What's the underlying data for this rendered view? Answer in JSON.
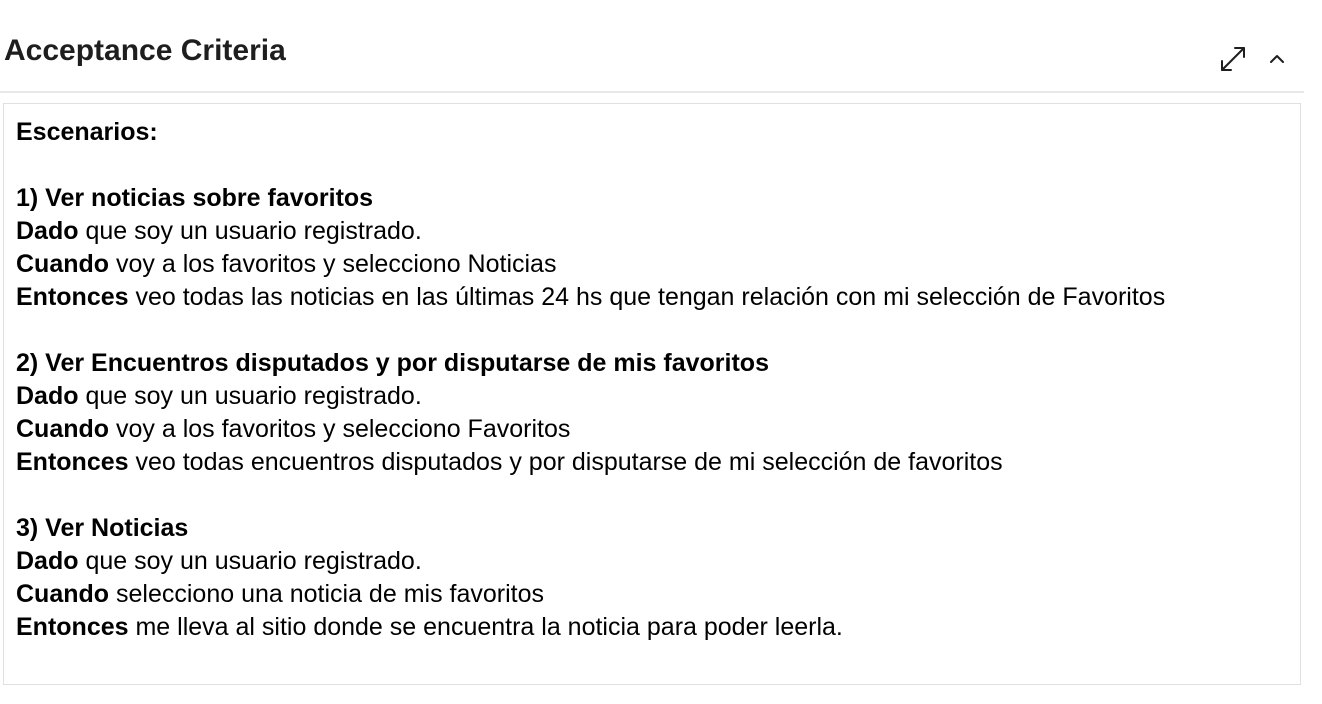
{
  "header": {
    "title": "Acceptance Criteria",
    "expand_icon": "expand-diagonal-icon",
    "collapse_icon": "chevron-up-icon"
  },
  "content": {
    "heading": "Escenarios:",
    "scenarios": [
      {
        "title": "1) Ver noticias sobre favoritos",
        "given_kw": "Dado",
        "given_text": " que soy un usuario registrado.",
        "when_kw": "Cuando",
        "when_text": " voy a los favoritos y selecciono Noticias",
        "then_kw": "Entonces",
        "then_text": " veo todas las noticias en las últimas 24 hs que tengan relación con mi selección de Favoritos"
      },
      {
        "title": "2) Ver Encuentros disputados y por disputarse de mis favoritos",
        "given_kw": "Dado",
        "given_text": " que soy un usuario registrado.",
        "when_kw": "Cuando",
        "when_text": " voy a los favoritos y selecciono Favoritos",
        "then_kw": "Entonces",
        "then_text": " veo todas encuentros disputados y por disputarse de mi selección de favoritos"
      },
      {
        "title": "3) Ver Noticias",
        "given_kw": "Dado",
        "given_text": " que soy un usuario registrado.",
        "when_kw": "Cuando",
        "when_text": " selecciono una noticia de mis favoritos",
        "then_kw": "Entonces",
        "then_text": " me lleva al sitio donde se encuentra la noticia para poder leerla."
      }
    ]
  },
  "colors": {
    "title": "#1e1e1e",
    "divider": "#e8e8e8",
    "border": "#e0e0e0",
    "text": "#000000"
  }
}
